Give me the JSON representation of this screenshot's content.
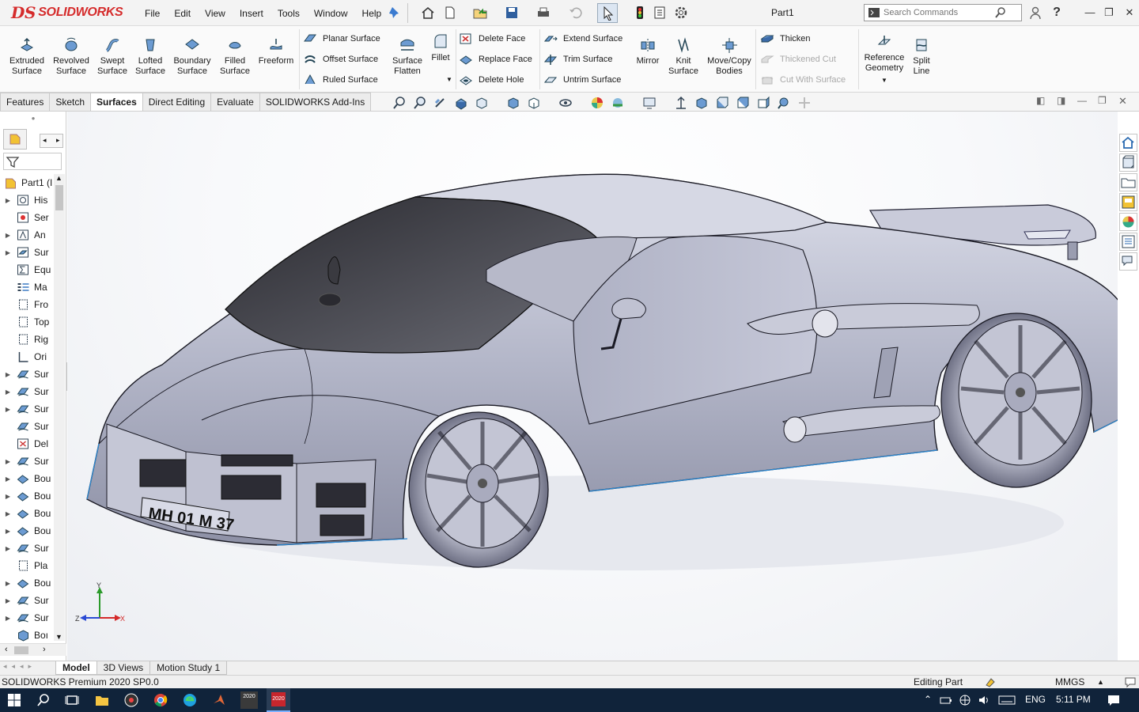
{
  "app": {
    "brand": "SOLIDWORKS",
    "brand_prefix": "DS",
    "document_title": "Part1"
  },
  "menu": [
    "File",
    "Edit",
    "View",
    "Insert",
    "Tools",
    "Window",
    "Help"
  ],
  "search": {
    "placeholder": "Search Commands"
  },
  "command_manager": {
    "large_buttons": [
      {
        "line1": "Extruded",
        "line2": "Surface",
        "icon": "extruded-surface-icon"
      },
      {
        "line1": "Revolved",
        "line2": "Surface",
        "icon": "revolved-surface-icon"
      },
      {
        "line1": "Swept",
        "line2": "Surface",
        "icon": "swept-surface-icon"
      },
      {
        "line1": "Lofted",
        "line2": "Surface",
        "icon": "lofted-surface-icon"
      },
      {
        "line1": "Boundary",
        "line2": "Surface",
        "icon": "boundary-surface-icon"
      },
      {
        "line1": "Filled",
        "line2": "Surface",
        "icon": "filled-surface-icon"
      },
      {
        "line1": "Freeform",
        "line2": "",
        "icon": "freeform-icon"
      }
    ],
    "group1": [
      "Planar Surface",
      "Offset Surface",
      "Ruled Surface"
    ],
    "flatten": {
      "line1": "Surface",
      "line2": "Flatten"
    },
    "fillet": "Fillet",
    "group2": [
      "Delete Face",
      "Replace Face",
      "Delete Hole"
    ],
    "group3": [
      "Extend Surface",
      "Trim Surface",
      "Untrim Surface"
    ],
    "mirror": "Mirror",
    "knit": {
      "line1": "Knit",
      "line2": "Surface"
    },
    "movecopy": {
      "line1": "Move/Copy",
      "line2": "Bodies"
    },
    "group4": [
      "Thicken",
      "Thickened Cut",
      "Cut With Surface"
    ],
    "refgeo": {
      "line1": "Reference",
      "line2": "Geometry"
    },
    "split": {
      "line1": "Split",
      "line2": "Line"
    }
  },
  "tabs": [
    {
      "label": "Features",
      "active": false
    },
    {
      "label": "Sketch",
      "active": false
    },
    {
      "label": "Surfaces",
      "active": true
    },
    {
      "label": "Direct Editing",
      "active": false
    },
    {
      "label": "Evaluate",
      "active": false
    },
    {
      "label": "SOLIDWORKS Add-Ins",
      "active": false
    }
  ],
  "feature_tree": [
    {
      "label": "Part1  (I",
      "expand": false,
      "icon": "part-icon"
    },
    {
      "label": "His",
      "expand": true,
      "icon": "history-icon"
    },
    {
      "label": "Ser",
      "expand": false,
      "icon": "sensors-icon"
    },
    {
      "label": "An",
      "expand": true,
      "icon": "annotations-icon"
    },
    {
      "label": "Sur",
      "expand": true,
      "icon": "surface-bodies-icon"
    },
    {
      "label": "Equ",
      "expand": false,
      "icon": "equations-icon"
    },
    {
      "label": "Ma",
      "expand": false,
      "icon": "material-icon"
    },
    {
      "label": "Fro",
      "expand": false,
      "icon": "plane-icon"
    },
    {
      "label": "Top",
      "expand": false,
      "icon": "plane-icon"
    },
    {
      "label": "Rig",
      "expand": false,
      "icon": "plane-icon"
    },
    {
      "label": "Ori",
      "expand": false,
      "icon": "origin-icon"
    },
    {
      "label": "Sur",
      "expand": true,
      "icon": "surface-feature-icon"
    },
    {
      "label": "Sur",
      "expand": true,
      "icon": "surface-feature-icon"
    },
    {
      "label": "Sur",
      "expand": true,
      "icon": "surface-feature-icon"
    },
    {
      "label": "Sur",
      "expand": false,
      "icon": "surface-feature-icon"
    },
    {
      "label": "Del",
      "expand": false,
      "icon": "delete-face-icon"
    },
    {
      "label": "Sur",
      "expand": true,
      "icon": "surface-feature-icon"
    },
    {
      "label": "Bou",
      "expand": true,
      "icon": "boundary-feature-icon"
    },
    {
      "label": "Bou",
      "expand": true,
      "icon": "boundary-feature-icon"
    },
    {
      "label": "Bou",
      "expand": true,
      "icon": "boundary-feature-icon"
    },
    {
      "label": "Bou",
      "expand": true,
      "icon": "boundary-feature-icon"
    },
    {
      "label": "Sur",
      "expand": true,
      "icon": "surface-feature-icon"
    },
    {
      "label": "Pla",
      "expand": false,
      "icon": "plane-icon"
    },
    {
      "label": "Bou",
      "expand": true,
      "icon": "boundary-feature-icon"
    },
    {
      "label": "Sur",
      "expand": true,
      "icon": "surface-feature-icon"
    },
    {
      "label": "Sur",
      "expand": true,
      "icon": "surface-feature-icon"
    },
    {
      "label": "Boı",
      "expand": false,
      "icon": "solid-body-icon"
    }
  ],
  "model": {
    "license_plate": "MH 01 M 37"
  },
  "triad": {
    "y": "Y",
    "z": "Z",
    "x": "X"
  },
  "bottom_tabs": [
    {
      "label": "Model",
      "active": true
    },
    {
      "label": "3D Views",
      "active": false
    },
    {
      "label": "Motion Study 1",
      "active": false
    }
  ],
  "status": {
    "product": "SOLIDWORKS Premium 2020 SP0.0",
    "mode": "Editing Part",
    "units": "MMGS"
  },
  "taskbar": {
    "language": "ENG",
    "time": "5:11 PM",
    "sw_badge": "2020"
  },
  "colors": {
    "accent": "#d52b2b",
    "taskbar": "#10233a",
    "model_body": "#b4b7c9"
  }
}
